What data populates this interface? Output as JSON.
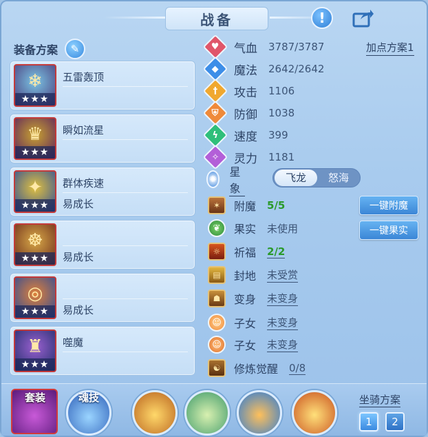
{
  "title": "战备",
  "plan": {
    "label": "装备方案",
    "add_point": "加点方案1"
  },
  "equipment": [
    {
      "name": "五雷轰顶",
      "sub": "",
      "stars": "★★★"
    },
    {
      "name": "瞬如流星",
      "sub": "",
      "stars": "★★★"
    },
    {
      "name": "群体疾速",
      "sub": "易成长",
      "stars": "★★★"
    },
    {
      "name": "",
      "sub": "易成长",
      "stars": "★★★"
    },
    {
      "name": "",
      "sub": "易成长",
      "stars": "★★★"
    },
    {
      "name": "噬魔",
      "sub": "",
      "stars": "★★★"
    }
  ],
  "stats": [
    {
      "label": "气血",
      "value": "3787/3787",
      "color": "#e0566a",
      "icon": "heart-icon"
    },
    {
      "label": "魔法",
      "value": "2642/2642",
      "color": "#3d8ee8",
      "icon": "mana-icon"
    },
    {
      "label": "攻击",
      "value": "1106",
      "color": "#f0a830",
      "icon": "sword-icon"
    },
    {
      "label": "防御",
      "value": "1038",
      "color": "#ef8a3a",
      "icon": "shield-icon"
    },
    {
      "label": "速度",
      "value": "399",
      "color": "#2fbf7a",
      "icon": "lightning-icon"
    },
    {
      "label": "灵力",
      "value": "1181",
      "color": "#b35fd8",
      "icon": "spirit-icon"
    }
  ],
  "star_sign": {
    "label": "星象",
    "options": [
      "飞龙",
      "怒海"
    ],
    "selected": "飞龙"
  },
  "extras": [
    {
      "label": "附魔",
      "value": "5/5",
      "style": "green"
    },
    {
      "label": "果实",
      "value": "未使用",
      "style": "plain"
    },
    {
      "label": "祈福",
      "value": "2/2",
      "style": "green-link"
    },
    {
      "label": "封地",
      "value": "未受赏",
      "style": "link"
    },
    {
      "label": "变身",
      "value": "未变身",
      "style": "link"
    },
    {
      "label": "子女",
      "value": "未变身",
      "style": "link"
    },
    {
      "label": "子女",
      "value": "未变身",
      "style": "link"
    },
    {
      "label": "修炼觉醒",
      "value": "0/8",
      "style": "link"
    }
  ],
  "buttons": {
    "enchant": "一键附魔",
    "fruit": "一键果实"
  },
  "bottom": {
    "suit": "套装",
    "skill": "魂技",
    "mount_label": "坐骑方案",
    "mounts": [
      "1",
      "2"
    ]
  }
}
